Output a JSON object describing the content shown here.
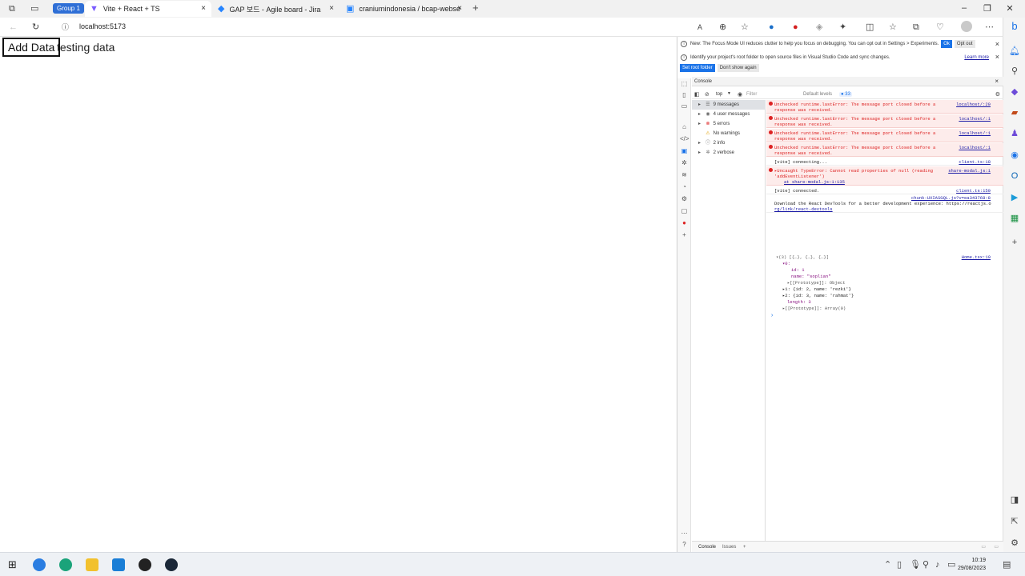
{
  "browser": {
    "group_label": "Group 1",
    "tabs": [
      {
        "title": "Vite + React + TS",
        "icon": "vite-icon",
        "active": true
      },
      {
        "title": "GAP 보드 - Agile board - Jira",
        "icon": "jira-icon",
        "active": false
      },
      {
        "title": "craniumindonesia / bcap-webse",
        "icon": "bitbucket-icon",
        "active": false
      }
    ],
    "address": "localhost:5173",
    "close_glyph": "×",
    "new_tab_glyph": "+"
  },
  "page": {
    "add_button": "Add Data",
    "text": "testing data"
  },
  "devtools": {
    "banner1": {
      "text": "New: The Focus Mode UI reduces clutter to help you focus on debugging. You can opt out in Settings > Experiments.",
      "ok": "Ok",
      "opt_out": "Opt out"
    },
    "banner2": {
      "text": "Identify your project's root folder to open source files in Visual Studio Code and sync changes.",
      "learn_more": "Learn more",
      "set_root": "Set root folder",
      "dont_show": "Don't show again"
    },
    "panel_title": "Console",
    "toolbar": {
      "context": "top",
      "filter_placeholder": "Filter",
      "levels": "Default levels",
      "issue_count": "33"
    },
    "filters": [
      {
        "label": "9 messages",
        "icon": "list-icon",
        "selected": true
      },
      {
        "label": "4 user messages",
        "icon": "user-icon",
        "selected": false
      },
      {
        "label": "5 errors",
        "icon": "error-icon",
        "selected": false
      },
      {
        "label": "No warnings",
        "icon": "warning-icon",
        "selected": false
      },
      {
        "label": "2 info",
        "icon": "info-icon",
        "selected": false
      },
      {
        "label": "2 verbose",
        "icon": "verbose-icon",
        "selected": false
      }
    ],
    "logs": [
      {
        "type": "error",
        "line1": "Unchecked runtime.lastError: The message port closed before a",
        "line2": "response was received.",
        "source": "localhost/:20"
      },
      {
        "type": "error",
        "line1": "Unchecked runtime.lastError: The message port closed before a",
        "line2": "response was received.",
        "source": "localhost/:1"
      },
      {
        "type": "error",
        "line1": "Unchecked runtime.lastError: The message port closed before a",
        "line2": "response was received.",
        "source": "localhost/:1"
      },
      {
        "type": "error",
        "line1": "Unchecked runtime.lastError: The message port closed before a",
        "line2": "response was received.",
        "source": "localhost/:1"
      },
      {
        "type": "plain",
        "line1": "[vite] connecting...",
        "line2": "",
        "source": "client.ts:18"
      },
      {
        "type": "error",
        "line1": "▸Uncaught TypeError: Cannot read properties of null (reading",
        "line2": "'addEventListener')",
        "line3": "at share-modal.js:1:135",
        "source": "share-modal.js:1"
      },
      {
        "type": "plain",
        "line1": "[vite] connected.",
        "line2": "",
        "source": "client.ts:150"
      },
      {
        "type": "plain",
        "line1": "Download the React DevTools for a better development experience: https://reactjs.o",
        "line2": "rg/link/react-devtools",
        "source": "chunk-UXIASGQL.js?v=ea343768:8"
      }
    ],
    "object_log": {
      "source": "Home.tsx:10",
      "lines": [
        "▾(3) [{…}, {…}, {…}]",
        "▾0:",
        "id: 1",
        "name: \"soplian\"",
        "▸[[Prototype]]: Object",
        "▸1: {id: 2, name: 'rezki'}",
        "▸2: {id: 3, name: 'rahmat'}",
        "length: 3",
        "▸[[Prototype]]: Array(0)"
      ],
      "prompt": "›"
    },
    "footer_tabs": [
      "Console",
      "Issues"
    ]
  },
  "taskbar": {
    "time": "10:19",
    "date": "29/08/2023"
  }
}
